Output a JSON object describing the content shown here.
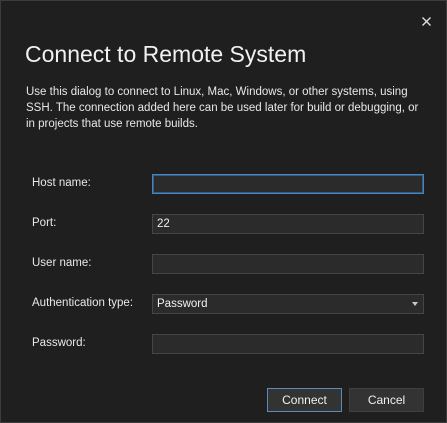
{
  "dialog": {
    "title": "Connect to Remote System",
    "description": "Use this dialog to connect to Linux, Mac, Windows, or other systems, using SSH. The connection added here can be used later for build or debugging, or in projects that use remote builds.",
    "close_icon": "close-icon"
  },
  "form": {
    "host_name": {
      "label": "Host name:",
      "value": ""
    },
    "port": {
      "label": "Port:",
      "value": "22"
    },
    "user_name": {
      "label": "User name:",
      "value": ""
    },
    "authentication_type": {
      "label": "Authentication type:",
      "value": "Password",
      "icon": "chevron-down-icon"
    },
    "password": {
      "label": "Password:",
      "value": ""
    }
  },
  "buttons": {
    "connect_label": "Connect",
    "cancel_label": "Cancel"
  },
  "colors": {
    "background": "#1f1f1f",
    "field_background": "#2b2b2b",
    "focus_border": "#4c84b8",
    "primary_button_border": "#5a8bbd",
    "text": "#f1f1f1"
  }
}
